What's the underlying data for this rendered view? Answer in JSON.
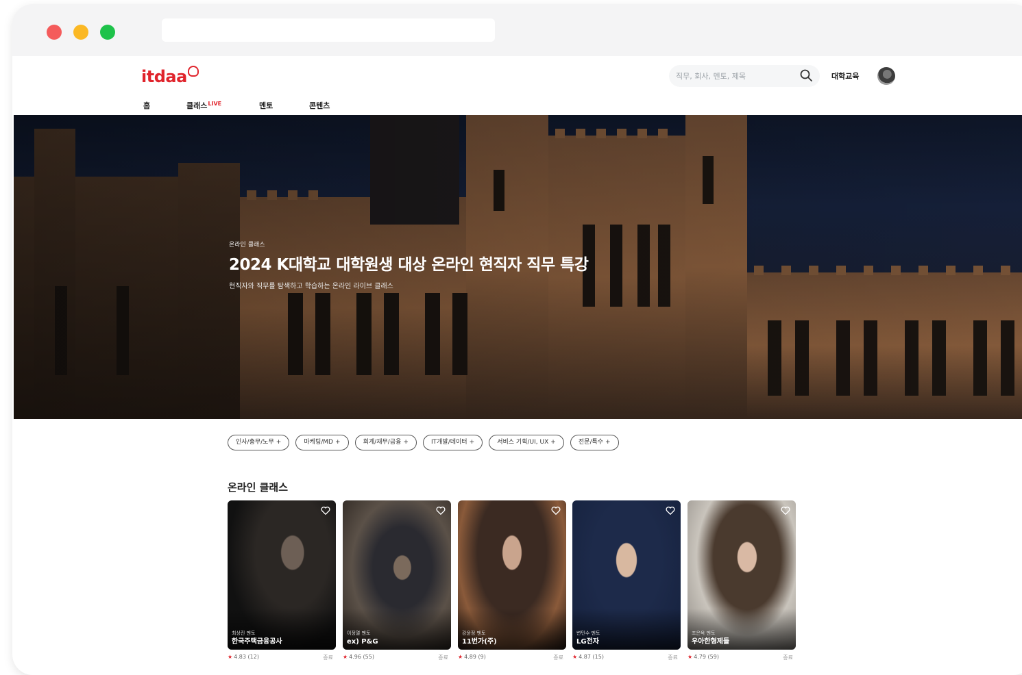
{
  "header": {
    "logo": "itdaa",
    "search_placeholder": "직무, 회사, 멘토, 제목",
    "university_link": "대학교육"
  },
  "nav": {
    "items": [
      {
        "label": "홈",
        "badge": ""
      },
      {
        "label": "클래스",
        "badge": "LIVE"
      },
      {
        "label": "멘토",
        "badge": ""
      },
      {
        "label": "콘텐츠",
        "badge": ""
      }
    ]
  },
  "hero": {
    "eyebrow": "온라인 클래스",
    "title": "2024 K대학교 대학원생 대상 온라인 현직자 직무 특강",
    "subtitle": "현직자와 직무를 탐색하고 학습하는 온라인 라이브 클래스"
  },
  "categories": [
    {
      "label": "인사/총무/노무",
      "plus": "+"
    },
    {
      "label": "마케팅/MD",
      "plus": "+"
    },
    {
      "label": "회계/재무/금융",
      "plus": "+"
    },
    {
      "label": "IT개발/데이터",
      "plus": "+"
    },
    {
      "label": "서비스 기획/UI, UX",
      "plus": "+"
    },
    {
      "label": "전문/특수",
      "plus": "+"
    }
  ],
  "online_classes": {
    "title": "온라인 클래스",
    "cards": [
      {
        "mentor": "최상진 멘토",
        "company": "한국주택금융공사",
        "rating": "4.83 (12)",
        "tag": "종료"
      },
      {
        "mentor": "이정열 멘토",
        "company": "ex) P&G",
        "rating": "4.96 (55)",
        "tag": "종료"
      },
      {
        "mentor": "강윤정 멘토",
        "company": "11번가(주)",
        "rating": "4.89 (9)",
        "tag": "종료"
      },
      {
        "mentor": "변민수 멘토",
        "company": "LG전자",
        "rating": "4.87 (15)",
        "tag": "종료"
      },
      {
        "mentor": "조은옥 멘토",
        "company": "우아한형제들",
        "rating": "4.79 (59)",
        "tag": "종료"
      }
    ]
  },
  "colors": {
    "brand": "#e0242c",
    "mac_red": "#f45b5b",
    "mac_yellow": "#fbb824",
    "mac_green": "#1ec24a"
  },
  "icons": {
    "search": "search-icon",
    "heart": "heart-icon"
  }
}
